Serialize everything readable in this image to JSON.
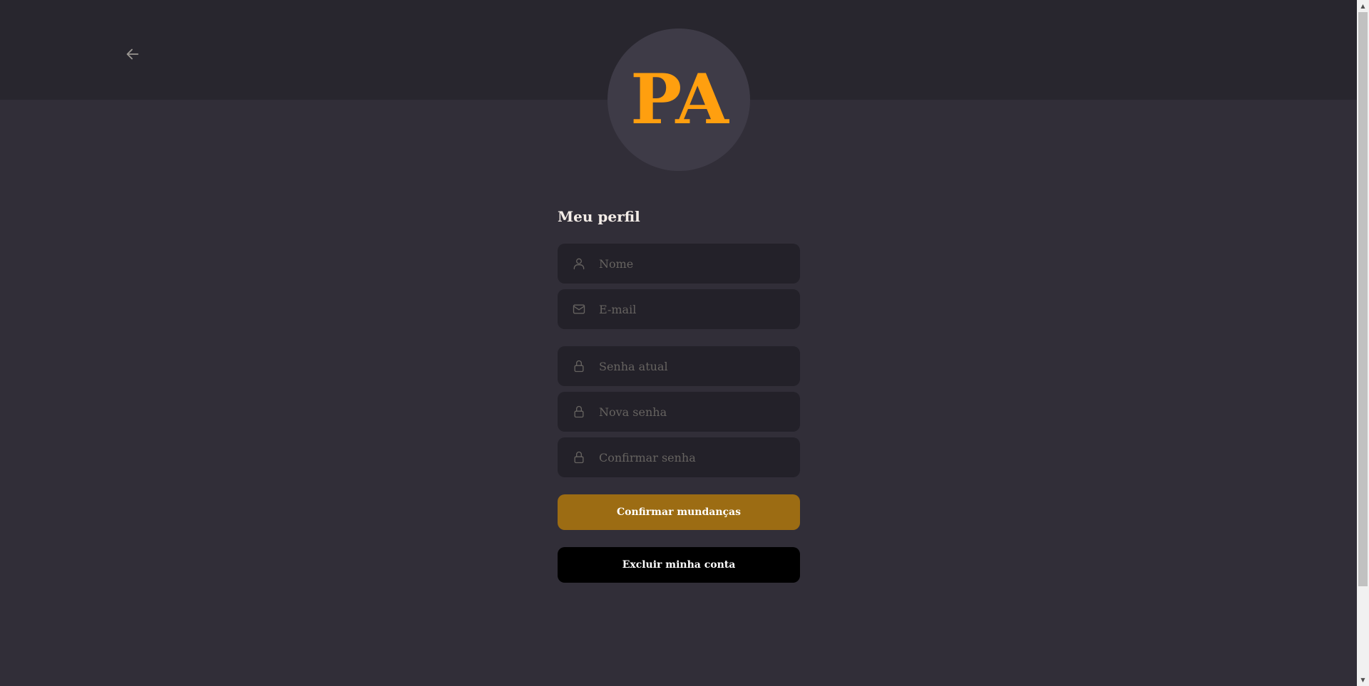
{
  "header": {
    "back_icon": "arrow-left-icon"
  },
  "avatar": {
    "initials": "PA",
    "color": "#ff9f0f"
  },
  "profile": {
    "title": "Meu perfil",
    "fields": {
      "name": {
        "placeholder": "Nome",
        "icon": "user-icon"
      },
      "email": {
        "placeholder": "E-mail",
        "icon": "mail-icon"
      },
      "current_password": {
        "placeholder": "Senha atual",
        "icon": "lock-icon"
      },
      "new_password": {
        "placeholder": "Nova senha",
        "icon": "lock-icon"
      },
      "confirm_password": {
        "placeholder": "Confirmar senha",
        "icon": "lock-icon"
      }
    },
    "confirm_button": "Confirmar mundanças",
    "delete_button": "Excluir minha conta"
  },
  "colors": {
    "background": "#312e38",
    "header": "#28262e",
    "input": "#232129",
    "accent": "#9c6c13",
    "avatar_bg": "#3e3b47"
  }
}
